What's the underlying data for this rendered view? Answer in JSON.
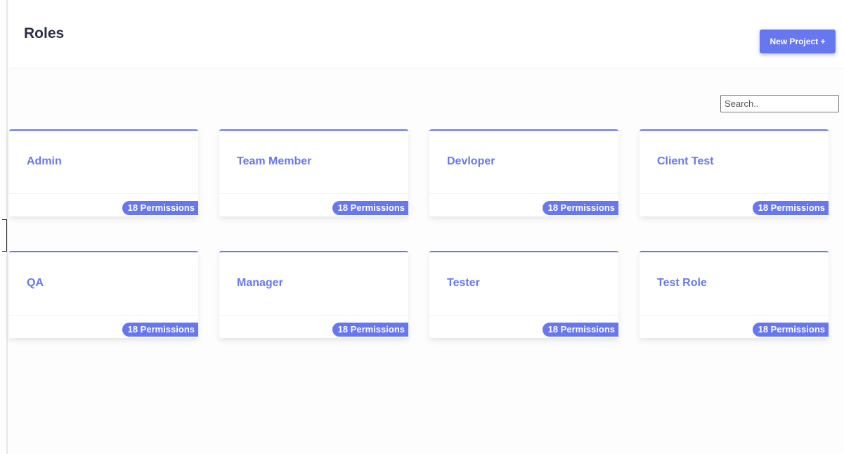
{
  "header": {
    "title": "Roles",
    "new_project_label": "New Project +"
  },
  "search": {
    "placeholder": "Search..",
    "value": ""
  },
  "roles": [
    {
      "name": "Admin",
      "badge": "18 Permissions"
    },
    {
      "name": "Team Member",
      "badge": "18 Permissions"
    },
    {
      "name": "Devloper",
      "badge": "18 Permissions"
    },
    {
      "name": "Client Test",
      "badge": "18 Permissions"
    },
    {
      "name": "QA",
      "badge": "18 Permissions"
    },
    {
      "name": "Manager",
      "badge": "18 Permissions"
    },
    {
      "name": "Tester",
      "badge": "18 Permissions"
    },
    {
      "name": "Test Role",
      "badge": "18 Permissions"
    }
  ],
  "colors": {
    "accent": "#6777ef",
    "title_text": "#2a2f45"
  }
}
